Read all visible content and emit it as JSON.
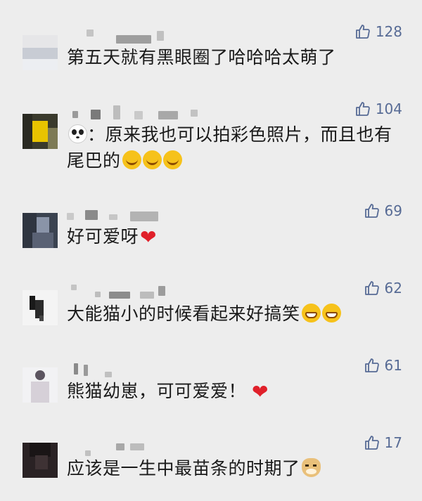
{
  "comments": [
    {
      "likes": "128",
      "text": "第五天就有黑眼圈了哈哈哈太萌了",
      "emoji": []
    },
    {
      "likes": "104",
      "text_line1": "：原来我也可以拍彩色照片，而且也有",
      "text_line2": "尾巴的",
      "prefix_emoji": "panda-emoji",
      "emoji": [
        "tears-of-joy-emoji",
        "tears-of-joy-emoji",
        "tears-of-joy-emoji"
      ]
    },
    {
      "likes": "69",
      "text": "好可爱呀",
      "emoji": [
        "red-heart-emoji"
      ]
    },
    {
      "likes": "62",
      "text": "大能猫小的时候看起来好搞笑",
      "emoji": [
        "grinning-emoji",
        "grinning-emoji"
      ]
    },
    {
      "likes": "61",
      "text": "熊猫幼崽，可可爱爱！",
      "emoji": [
        "red-heart-emoji"
      ]
    },
    {
      "likes": "17",
      "text": "应该是一生中最苗条的时期了",
      "emoji": [
        "doge-emoji"
      ]
    }
  ],
  "like_icon": "thumbs-up-icon",
  "colors": {
    "background": "#ededed",
    "like": "#576b95",
    "text": "#1a1a1a",
    "heart": "#e0202a"
  }
}
